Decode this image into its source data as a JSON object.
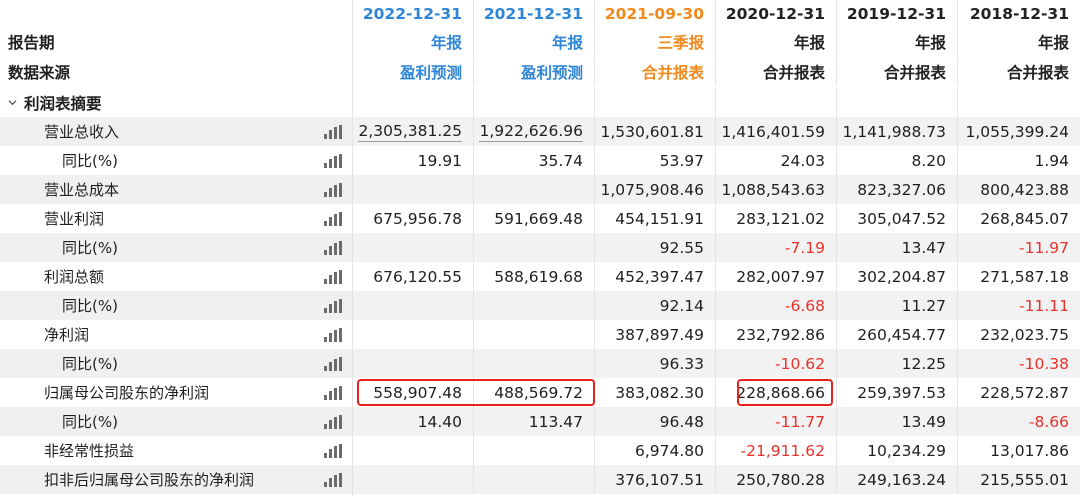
{
  "header": {
    "row_period_label": "报告期",
    "row_source_label": "数据来源",
    "columns": [
      {
        "date": "2022-12-31",
        "period": "年报",
        "source": "盈利预测",
        "tone": "blue"
      },
      {
        "date": "2021-12-31",
        "period": "年报",
        "source": "盈利预测",
        "tone": "blue"
      },
      {
        "date": "2021-09-30",
        "period": "三季报",
        "source": "合并报表",
        "tone": "orange"
      },
      {
        "date": "2020-12-31",
        "period": "年报",
        "source": "合并报表",
        "tone": "dark"
      },
      {
        "date": "2019-12-31",
        "period": "年报",
        "source": "合并报表",
        "tone": "dark"
      },
      {
        "date": "2018-12-31",
        "period": "年报",
        "source": "合并报表",
        "tone": "dark"
      }
    ]
  },
  "section": {
    "title": "利润表摘要",
    "icon": "chevron-down-icon"
  },
  "rows": [
    {
      "label": "营业总收入",
      "indent": 1,
      "values": [
        "2,305,381.25",
        "1,922,626.96",
        "1,530,601.81",
        "1,416,401.59",
        "1,141,988.73",
        "1,055,399.24"
      ]
    },
    {
      "label": "同比(%)",
      "indent": 2,
      "values": [
        "19.91",
        "35.74",
        "53.97",
        "24.03",
        "8.20",
        "1.94"
      ]
    },
    {
      "label": "营业总成本",
      "indent": 1,
      "values": [
        "",
        "",
        "1,075,908.46",
        "1,088,543.63",
        "823,327.06",
        "800,423.88"
      ]
    },
    {
      "label": "营业利润",
      "indent": 1,
      "values": [
        "675,956.78",
        "591,669.48",
        "454,151.91",
        "283,121.02",
        "305,047.52",
        "268,845.07"
      ]
    },
    {
      "label": "同比(%)",
      "indent": 2,
      "values": [
        "",
        "",
        "92.55",
        "-7.19",
        "13.47",
        "-11.97"
      ]
    },
    {
      "label": "利润总额",
      "indent": 1,
      "values": [
        "676,120.55",
        "588,619.68",
        "452,397.47",
        "282,007.97",
        "302,204.87",
        "271,587.18"
      ]
    },
    {
      "label": "同比(%)",
      "indent": 2,
      "values": [
        "",
        "",
        "92.14",
        "-6.68",
        "11.27",
        "-11.11"
      ]
    },
    {
      "label": "净利润",
      "indent": 1,
      "values": [
        "",
        "",
        "387,897.49",
        "232,792.86",
        "260,454.77",
        "232,023.75"
      ]
    },
    {
      "label": "同比(%)",
      "indent": 2,
      "values": [
        "",
        "",
        "96.33",
        "-10.62",
        "12.25",
        "-10.38"
      ]
    },
    {
      "label": "归属母公司股东的净利润",
      "indent": 1,
      "values": [
        "558,907.48",
        "488,569.72",
        "383,082.30",
        "228,868.66",
        "259,397.53",
        "228,572.87"
      ]
    },
    {
      "label": "同比(%)",
      "indent": 2,
      "values": [
        "14.40",
        "113.47",
        "96.48",
        "-11.77",
        "13.49",
        "-8.66"
      ]
    },
    {
      "label": "非经常性损益",
      "indent": 1,
      "values": [
        "",
        "",
        "6,974.80",
        "-21,911.62",
        "10,234.29",
        "13,017.86"
      ]
    },
    {
      "label": "扣非后归属母公司股东的净利润",
      "indent": 1,
      "values": [
        "",
        "",
        "376,107.51",
        "250,780.28",
        "249,163.24",
        "215,555.01"
      ]
    }
  ],
  "colors": {
    "forecast_blue": "#2f86d6",
    "quarter_orange": "#f08a1c",
    "negative_red": "#e8312c",
    "highlight_red": "#e8211c"
  },
  "row_icon": "bar-chart-icon"
}
